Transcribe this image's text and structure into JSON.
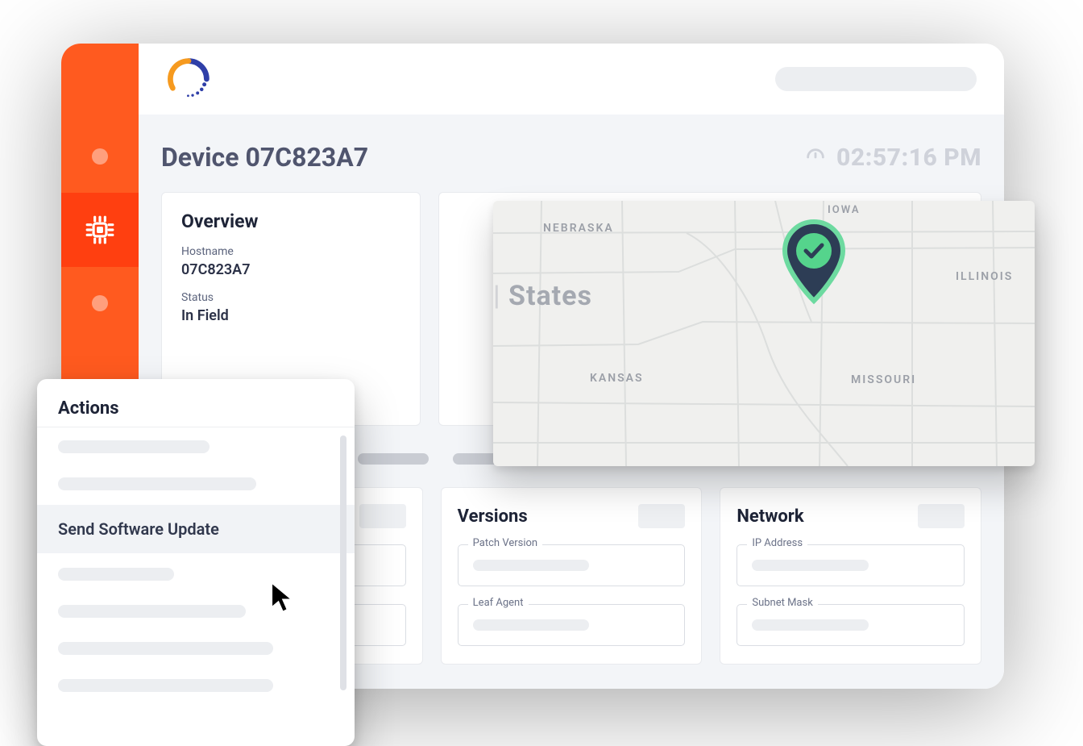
{
  "page": {
    "title": "Device 07C823A7",
    "clock": "02:57:16 PM"
  },
  "overview": {
    "heading": "Overview",
    "hostname_label": "Hostname",
    "hostname_value": "07C823A7",
    "status_label": "Status",
    "status_value": "In Field"
  },
  "map": {
    "country_label": "States",
    "labels": {
      "nebraska": "NEBRASKA",
      "kansas": "KANSAS",
      "iowa": "IOWA",
      "missouri": "MISSOURI",
      "illinois": "ILLINOIS"
    }
  },
  "detail_cards": {
    "device": {
      "title": ""
    },
    "versions": {
      "title": "Versions",
      "field1": "Patch Version",
      "field2": "Leaf Agent"
    },
    "network": {
      "title": "Network",
      "field1": "IP Address",
      "field2": "Subnet Mask"
    }
  },
  "actions": {
    "heading": "Actions",
    "primary": "Send Software Update"
  }
}
